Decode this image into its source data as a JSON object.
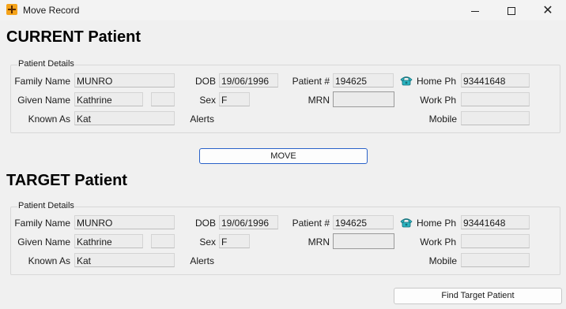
{
  "window": {
    "title": "Move Record",
    "minimize_icon": "minimize-icon",
    "maximize_icon": "maximize-icon",
    "close_icon": "close-icon"
  },
  "current": {
    "heading": "CURRENT Patient",
    "group_label": "Patient Details",
    "labels": {
      "family_name": "Family Name",
      "given_name": "Given Name",
      "known_as": "Known As",
      "dob": "DOB",
      "sex": "Sex",
      "alerts": "Alerts",
      "patient_no": "Patient #",
      "mrn": "MRN",
      "home_ph": "Home Ph",
      "work_ph": "Work Ph",
      "mobile": "Mobile"
    },
    "values": {
      "family_name": "MUNRO",
      "given_name": "Kathrine",
      "given_name_extra": "",
      "known_as": "Kat",
      "dob": "19/06/1996",
      "sex": "F",
      "patient_no": "194625",
      "mrn": "",
      "home_ph": "93441648",
      "work_ph": "",
      "mobile": ""
    }
  },
  "move_button": "MOVE",
  "target": {
    "heading": "TARGET Patient",
    "group_label": "Patient Details",
    "labels": {
      "family_name": "Family Name",
      "given_name": "Given Name",
      "known_as": "Known As",
      "dob": "DOB",
      "sex": "Sex",
      "alerts": "Alerts",
      "patient_no": "Patient #",
      "mrn": "MRN",
      "home_ph": "Home Ph",
      "work_ph": "Work Ph",
      "mobile": "Mobile"
    },
    "values": {
      "family_name": "MUNRO",
      "given_name": "Kathrine",
      "given_name_extra": "",
      "known_as": "Kat",
      "dob": "19/06/1996",
      "sex": "F",
      "patient_no": "194625",
      "mrn": "",
      "home_ph": "93441648",
      "work_ph": "",
      "mobile": ""
    }
  },
  "find_button": "Find Target Patient",
  "colors": {
    "accent": "#2a62c9",
    "phone_icon": "#2bb3c0",
    "app_icon": "#f5a31a"
  }
}
